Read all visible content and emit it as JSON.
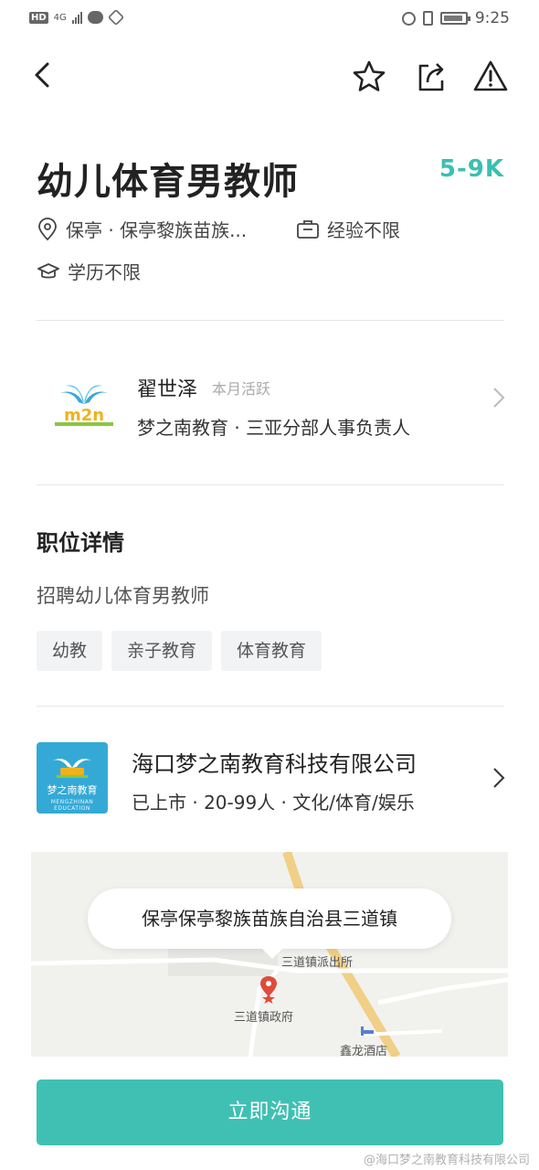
{
  "status_bar": {
    "hd": "HD",
    "network": "4G",
    "time": "9:25"
  },
  "nav": {
    "back_icon": "chevron-left-icon",
    "favorite_icon": "star-icon",
    "share_icon": "share-icon",
    "report_icon": "warning-icon"
  },
  "job": {
    "title": "幼儿体育男教师",
    "salary": "5-9K",
    "location": "保亭 · 保亭黎族苗族...",
    "experience": "经验不限",
    "education": "学历不限"
  },
  "recruiter": {
    "name": "翟世泽",
    "active_status": "本月活跃",
    "role": "梦之南教育 · 三亚分部人事负责人",
    "logo_text": "m2n"
  },
  "details": {
    "section_title": "职位详情",
    "description": "招聘幼儿体育男教师",
    "tags": [
      "幼教",
      "亲子教育",
      "体育教育"
    ]
  },
  "company": {
    "name": "海口梦之南教育科技有限公司",
    "info": "已上市 · 20-99人 · 文化/体育/娱乐",
    "logo_text": "梦之南教育",
    "logo_sub": "MENGZHINAN EDUCATION"
  },
  "map": {
    "address": "保亭保亭黎族苗族自治县三道镇",
    "poi_police": "三道镇派出所",
    "poi_gov": "三道镇政府",
    "poi_hotel": "鑫龙酒店"
  },
  "cta_label": "立即沟通",
  "watermark": "@海口梦之南教育科技有限公司",
  "colors": {
    "accent": "#3fc0b3",
    "salary": "#3bbfb1"
  }
}
